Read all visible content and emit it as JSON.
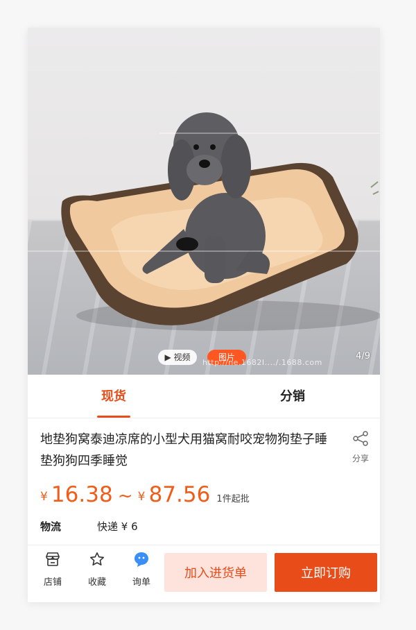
{
  "media": {
    "video_label": "▶ 视频",
    "photo_label": "图片",
    "counter": "4/9",
    "watermark": "http://ne.1682I..../.1688.com"
  },
  "tabs": [
    {
      "label": "现货",
      "active": true
    },
    {
      "label": "分销",
      "active": false
    }
  ],
  "product": {
    "title": "地垫狗窝泰迪凉席的小型犬用猫窝耐咬宠物狗垫子睡垫狗狗四季睡觉",
    "share_label": "分享"
  },
  "price": {
    "currency": "¥",
    "low": "16.38",
    "separator": "~",
    "high": "87.56",
    "moq": "1件起批"
  },
  "logistics": {
    "label": "物流",
    "value": "快递 ¥ 6"
  },
  "bottom_bar": {
    "store_label": "店铺",
    "favorite_label": "收藏",
    "inquiry_label": "询单",
    "add_cart_label": "加入进货单",
    "buy_now_label": "立即订购"
  },
  "colors": {
    "accent": "#e84c19",
    "price": "#f25c19",
    "chat_blue": "#3a8ef6"
  }
}
